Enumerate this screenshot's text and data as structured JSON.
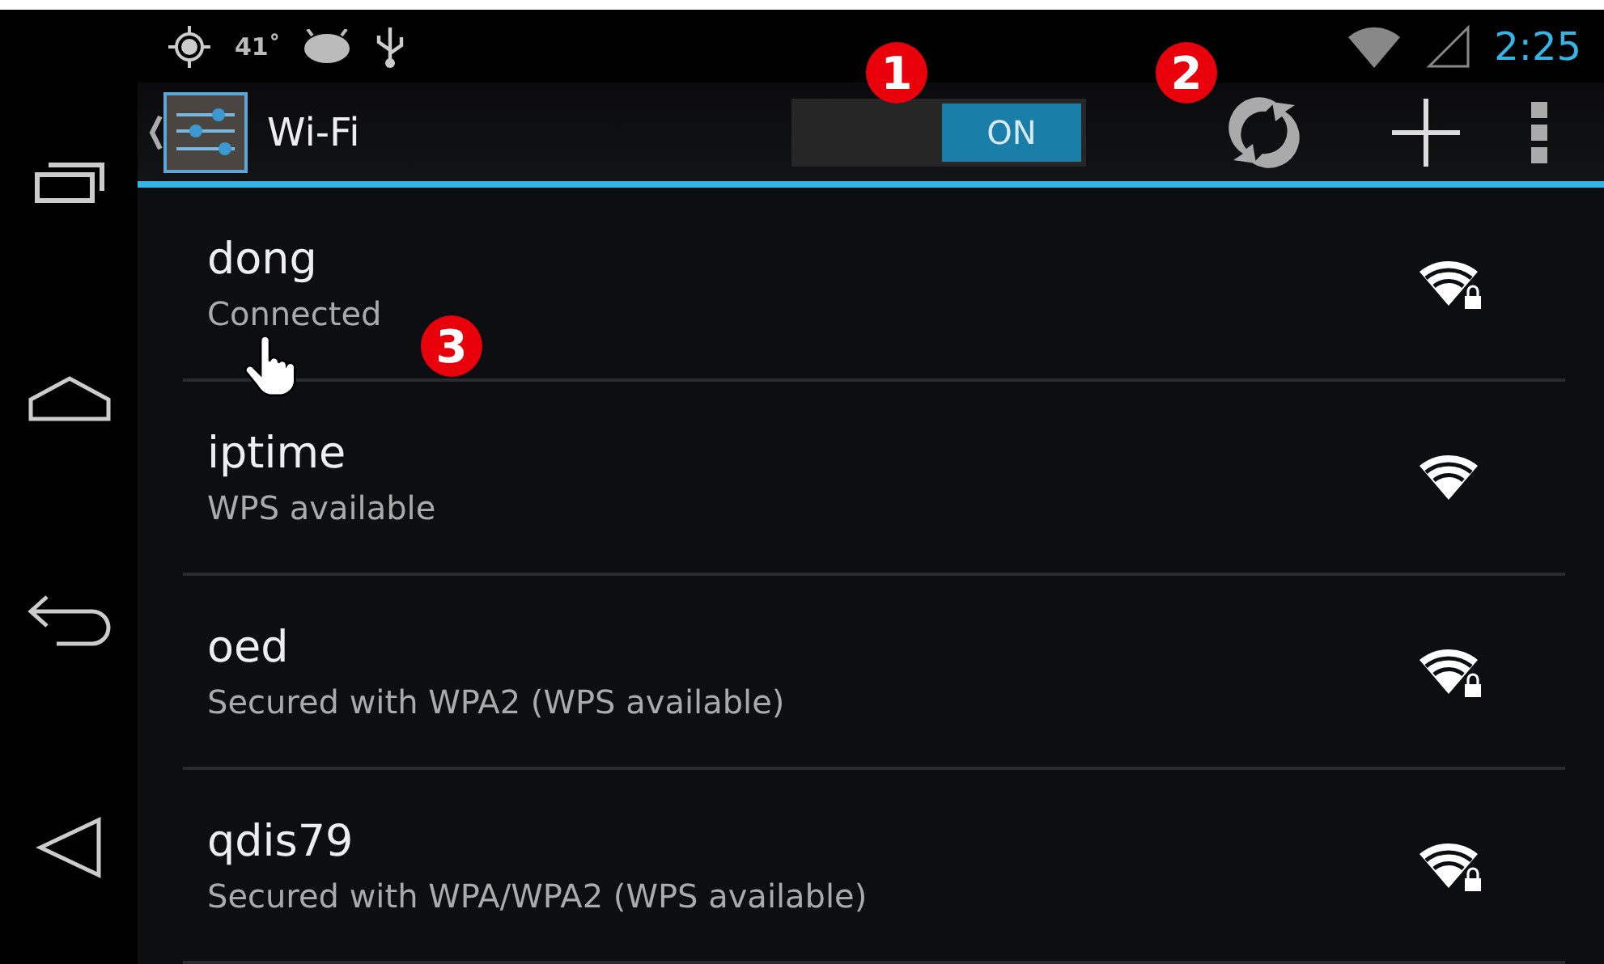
{
  "status_bar": {
    "temperature": "41˚",
    "time": "2:25"
  },
  "action_bar": {
    "title": "Wi-Fi",
    "toggle": {
      "label": "ON",
      "on": true
    }
  },
  "networks": [
    {
      "name": "dong",
      "status": "Connected",
      "secured": true
    },
    {
      "name": "iptime",
      "status": "WPS available",
      "secured": false
    },
    {
      "name": "oed",
      "status": "Secured with WPA2 (WPS available)",
      "secured": true
    },
    {
      "name": "qdis79",
      "status": "Secured with WPA/WPA2 (WPS available)",
      "secured": true
    }
  ],
  "annotations": [
    "1",
    "2",
    "3"
  ]
}
